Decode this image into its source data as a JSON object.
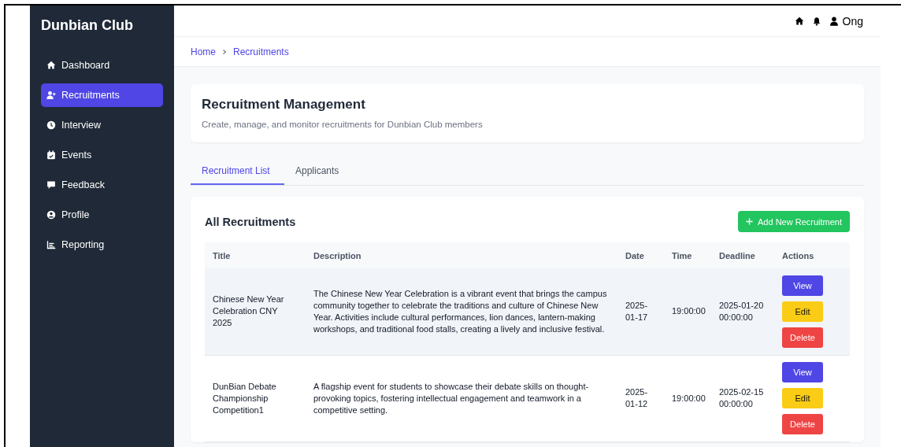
{
  "sidebar": {
    "title": "Dunbian Club",
    "items": [
      {
        "label": "Dashboard",
        "selected": false
      },
      {
        "label": "Recruitments",
        "selected": true
      },
      {
        "label": "Interview",
        "selected": false
      },
      {
        "label": "Events",
        "selected": false
      },
      {
        "label": "Feedback",
        "selected": false
      },
      {
        "label": "Profile",
        "selected": false
      },
      {
        "label": "Reporting",
        "selected": false
      }
    ]
  },
  "topbar": {
    "user": "Ong"
  },
  "breadcrumb": [
    "Home",
    "Recruitments"
  ],
  "header": {
    "title": "Recruitment Management",
    "subtitle": "Create, manage, and monitor recruitments for Dunbian Club members"
  },
  "tabs": [
    {
      "label": "Recruitment List",
      "selected": true
    },
    {
      "label": "Applicants",
      "selected": false
    }
  ],
  "table_card": {
    "title": "All Recruitments",
    "add_button": "Add New Recruitment"
  },
  "table": {
    "columns": [
      "Title",
      "Description",
      "Date",
      "Time",
      "Deadline",
      "Actions"
    ],
    "rows": [
      {
        "highlighted": true,
        "title": "Chinese New Year Celebration CNY 2025",
        "description": "The Chinese New Year Celebration is a vibrant event that brings the campus community together to celebrate the traditions and culture of Chinese New Year. Activities include cultural performances, lion dances, lantern-making workshops, and traditional food stalls, creating a lively and inclusive festival.",
        "date": "2025-01-17",
        "time": "19:00:00",
        "deadline": "2025-01-20 00:00:00",
        "actions": [
          {
            "kind": "view",
            "label": "View"
          },
          {
            "kind": "edit",
            "label": "Edit"
          },
          {
            "kind": "delete",
            "label": "Delete"
          }
        ]
      },
      {
        "highlighted": false,
        "title": "DunBian Debate Championship Competition1",
        "description": "A flagship event for students to showcase their debate skills on thought-provoking topics, fostering intellectual engagement and teamwork in a competitive setting.",
        "date": "2025-01-12",
        "time": "19:00:00",
        "deadline": "2025-02-15 00:00:00",
        "actions": [
          {
            "kind": "view",
            "label": "View"
          },
          {
            "kind": "edit",
            "label": "Edit"
          },
          {
            "kind": "delete",
            "label": "Delete"
          }
        ]
      }
    ]
  }
}
